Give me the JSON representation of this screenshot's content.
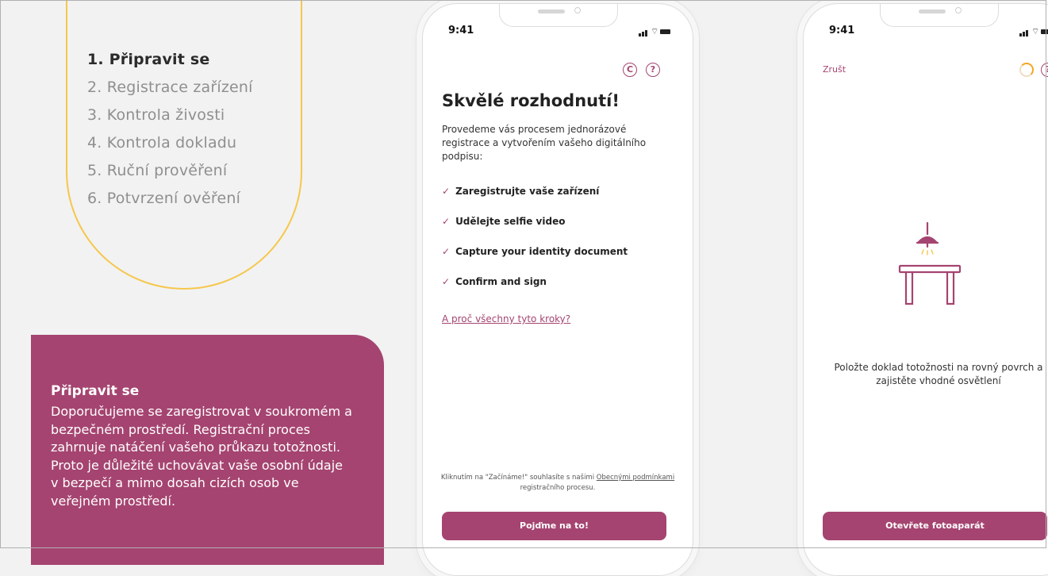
{
  "steps": [
    {
      "label": "1. Připravit se",
      "active": true
    },
    {
      "label": "2. Registrace zařízení",
      "active": false
    },
    {
      "label": "3. Kontrola živosti",
      "active": false
    },
    {
      "label": "4. Kontrola dokladu",
      "active": false
    },
    {
      "label": "5. Ruční prověření",
      "active": false
    },
    {
      "label": "6. Potvrzení ověření",
      "active": false
    }
  ],
  "info": {
    "title": "Připravit se",
    "body": "Doporučujeme se zaregistrovat v soukromém a bezpečném prostředí. Registrační proces zahrnuje natáčení vašeho průkazu totožnosti. Proto je důležité uchovávat vaše osobní údaje v bezpečí a mimo dosah cizích osob ve veřejném prostředí."
  },
  "phone1": {
    "time": "9:41",
    "title": "Skvělé rozhodnutí!",
    "intro": "Provedeme vás procesem jednorázové registrace a vytvořením vašeho digitálního podpisu:",
    "checklist": [
      "Zaregistrujte vaše zařízení",
      "Udělejte selfie video",
      "Capture your identity document",
      "Confirm and sign"
    ],
    "check_glyph": "✓",
    "why_link": "A proč všechny tyto kroky?",
    "consent_prefix": "Kliknutím na \"Začínáme!\" souhlasíte s našimi",
    "consent_link": "Obecnými podmínkami",
    "consent_suffix": "registračního procesu.",
    "button": "Pojďme na to!",
    "chat_icon_glyph": "C",
    "help_icon_glyph": "?"
  },
  "phone2": {
    "time": "9:41",
    "cancel": "Zrušt",
    "help_icon_glyph": "?",
    "instruction": "Položte doklad totožnosti na rovný povrch a zajistěte vhodné osvětlení",
    "button": "Otevřete fotoaparát"
  },
  "colors": {
    "brand": "#a54470",
    "accent_yellow": "#f5c74b",
    "spinner": "#f5a623"
  },
  "icons": [
    "chat-icon",
    "help-icon",
    "check-icon",
    "lamp-table-illustration",
    "spinner-icon",
    "signal-icon",
    "wifi-icon",
    "battery-icon"
  ]
}
